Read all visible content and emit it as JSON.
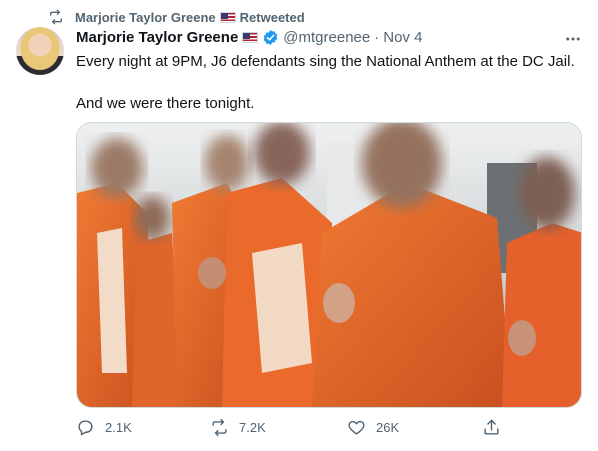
{
  "retweet_banner": {
    "name": "Marjorie Taylor Greene",
    "label": "Retweeted",
    "icon": "retweet-icon"
  },
  "tweet": {
    "author_name": "Marjorie Taylor Greene",
    "handle": "@mtgreenee",
    "separator": "·",
    "date": "Nov 4",
    "verified_icon": "verified-badge-icon",
    "text_line1": "Every night at 9PM, J6 defendants sing the National Anthem at the DC Jail.",
    "text_line2": "And we were there tonight."
  },
  "actions": {
    "replies": "2.1K",
    "retweets": "7.2K",
    "likes": "26K"
  },
  "colors": {
    "text_primary": "#0f1419",
    "text_secondary": "#536471",
    "verified_blue": "#1d9bf0",
    "prison_orange": "#e4622a"
  }
}
